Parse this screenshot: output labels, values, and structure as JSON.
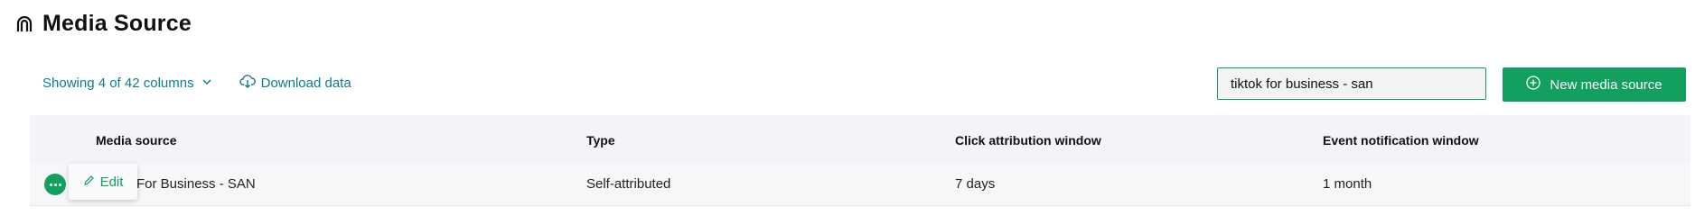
{
  "header": {
    "title": "Media Source",
    "icon": "magnet-icon"
  },
  "toolbar": {
    "columns_label": "Showing 4 of 42 columns",
    "download_label": "Download data",
    "search_value": "tiktok for business - san",
    "new_button_label": "New media source"
  },
  "table": {
    "columns": [
      "Media source",
      "Type",
      "Click attribution window",
      "Event notification window"
    ],
    "rows": [
      {
        "media_source": "For Business - SAN",
        "type": "Self-attributed",
        "click_window": "7 days",
        "event_window": "1 month"
      }
    ],
    "row_action_label": "Edit"
  },
  "colors": {
    "accent": "#139f5e",
    "link": "#0a7d8c",
    "header_bg": "#f3f4f7"
  }
}
